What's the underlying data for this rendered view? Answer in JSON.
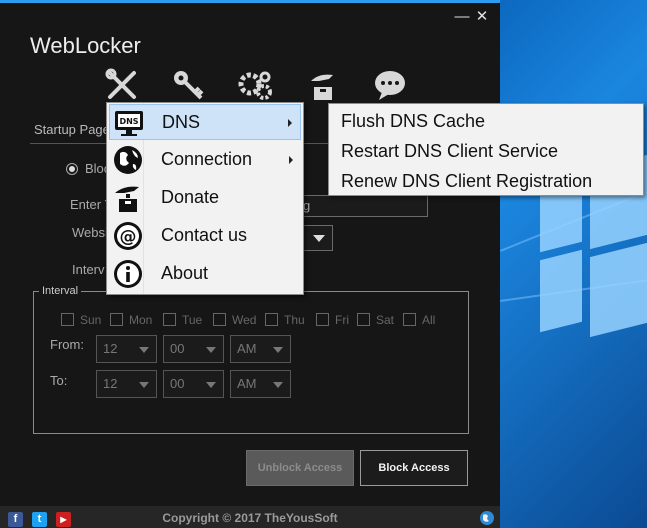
{
  "app": {
    "title": "WebLocker",
    "minimize_glyph": "—",
    "close_glyph": "✕"
  },
  "toolbar": {
    "icons": [
      "tools-icon",
      "key-icon",
      "gears-icon",
      "donate-icon",
      "chat-icon"
    ]
  },
  "main": {
    "tab_label": "Startup Page",
    "radio_label": "Block",
    "enter_label": "Enter Y",
    "input_value_fragment": "g",
    "website_label": "Websi",
    "interval_label_fragment": "Interv"
  },
  "interval": {
    "legend": "Interval",
    "days": [
      "Sun",
      "Mon",
      "Tue",
      "Wed",
      "Thu",
      "Fri",
      "Sat",
      "All"
    ],
    "from_label": "From:",
    "to_label": "To:",
    "from": {
      "hour": "12",
      "minute": "00",
      "ampm": "AM"
    },
    "to": {
      "hour": "12",
      "minute": "00",
      "ampm": "AM"
    }
  },
  "buttons": {
    "unblock": "Unblock Access",
    "block": "Block Access"
  },
  "footer": {
    "copyright": "Copyright © 2017 TheYousSoft",
    "social": {
      "facebook": "f",
      "twitter": "t",
      "youtube": "▶"
    }
  },
  "context_menu": {
    "items": [
      {
        "label": "DNS",
        "icon": "monitor-dns-icon",
        "has_submenu": true
      },
      {
        "label": "Connection",
        "icon": "globe-connection-icon",
        "has_submenu": true
      },
      {
        "label": "Donate",
        "icon": "donate-hand-icon",
        "has_submenu": false
      },
      {
        "label": "Contact us",
        "icon": "at-sign-icon",
        "has_submenu": false
      },
      {
        "label": "About",
        "icon": "info-icon",
        "has_submenu": false
      }
    ]
  },
  "dns_submenu": {
    "items": [
      "Flush DNS Cache",
      "Restart DNS Client Service",
      "Renew DNS Client Registration"
    ]
  },
  "colors": {
    "window_bg": "#161616",
    "accent_border": "#2e9cf0",
    "menu_highlight": "#cfe3f8"
  }
}
